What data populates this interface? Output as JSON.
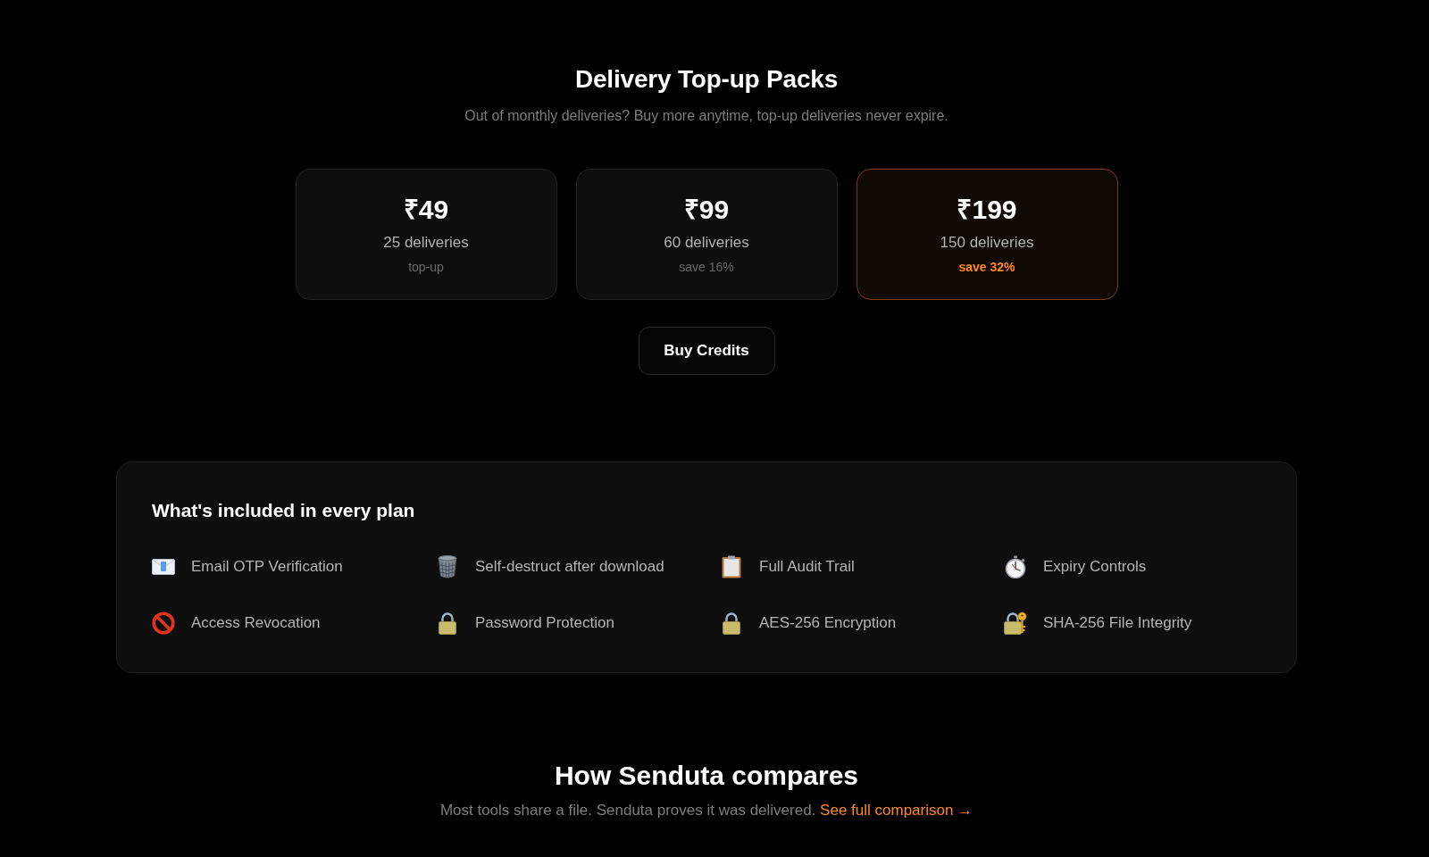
{
  "topup": {
    "title": "Delivery Top-up Packs",
    "subtitle": "Out of monthly deliveries? Buy more anytime, top-up deliveries never expire.",
    "packs": [
      {
        "price": "₹49",
        "deliveries": "25 deliveries",
        "note": "top-up",
        "selected": false
      },
      {
        "price": "₹99",
        "deliveries": "60 deliveries",
        "note": "save 16%",
        "selected": false
      },
      {
        "price": "₹199",
        "deliveries": "150 deliveries",
        "note": "save 32%",
        "selected": true
      }
    ],
    "button": "Buy Credits"
  },
  "included": {
    "title": "What's included in every plan",
    "features": [
      "Email OTP Verification",
      "Self-destruct after download",
      "Full Audit Trail",
      "Expiry Controls",
      "Access Revocation",
      "Password Protection",
      "AES-256 Encryption",
      "SHA-256 File Integrity"
    ]
  },
  "compare": {
    "title": "How Senduta compares",
    "text": "Most tools share a file. Senduta proves it was delivered.",
    "link": "See full comparison →"
  }
}
